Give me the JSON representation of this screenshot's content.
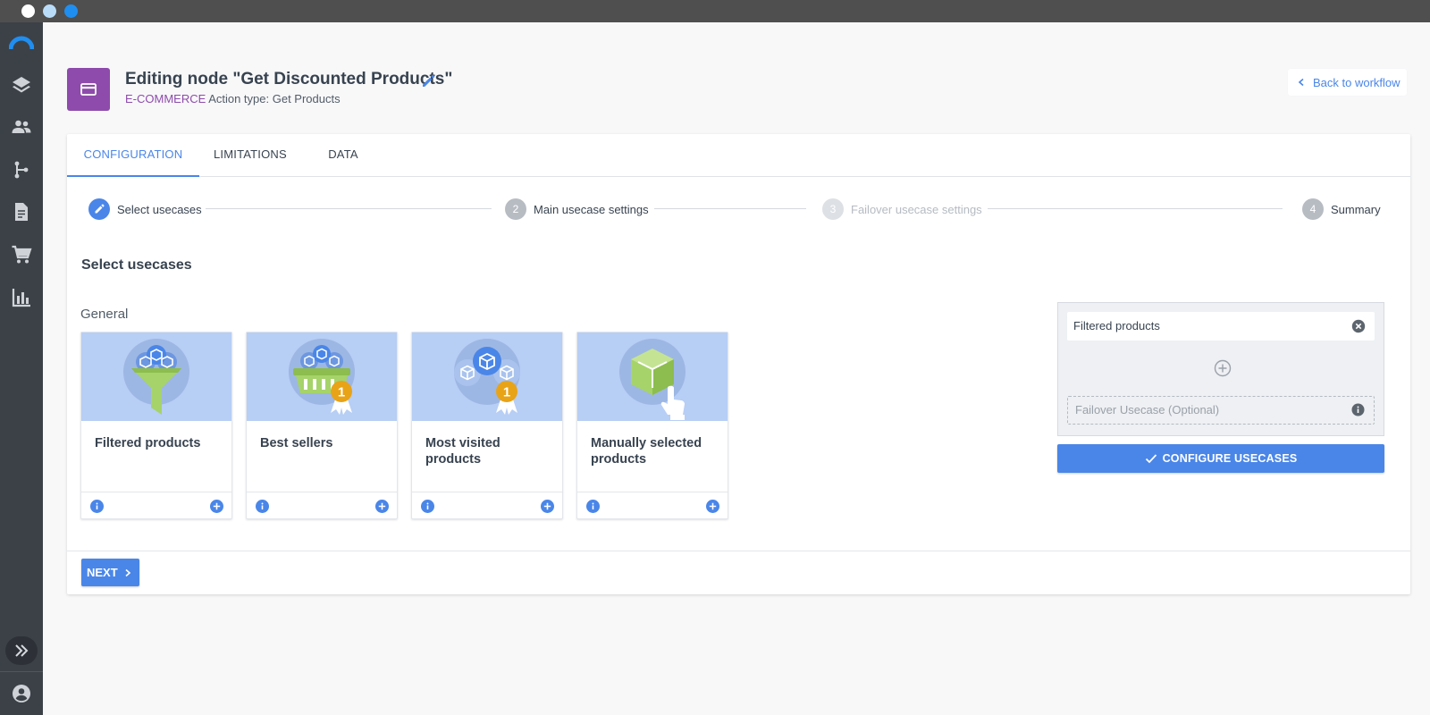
{
  "window": {
    "controls": [
      "close",
      "minimize",
      "maximize"
    ]
  },
  "sidebar": {
    "logo": "brand-logo",
    "items": [
      {
        "icon": "layers-icon"
      },
      {
        "icon": "users-icon"
      },
      {
        "icon": "workflow-icon"
      },
      {
        "icon": "document-icon"
      },
      {
        "icon": "cart-icon"
      },
      {
        "icon": "analytics-icon"
      }
    ],
    "expand_icon": "double-chevron-right-icon",
    "user_icon": "account-icon"
  },
  "header": {
    "title": "Editing node \"Get Discounted Products\"",
    "category": "E-COMMERCE",
    "action_type": "Action type: Get Products",
    "back_label": "Back to workflow",
    "node_color": "#8e4bab"
  },
  "tabs": [
    {
      "label": "CONFIGURATION",
      "active": true
    },
    {
      "label": "LIMITATIONS",
      "active": false
    },
    {
      "label": "DATA",
      "active": false
    }
  ],
  "stepper": [
    {
      "number": "",
      "label": "Select usecases",
      "state": "done"
    },
    {
      "number": "2",
      "label": "Main usecase settings",
      "state": "pending"
    },
    {
      "number": "3",
      "label": "Failover usecase settings",
      "state": "disabled"
    },
    {
      "number": "4",
      "label": "Summary",
      "state": "pending"
    }
  ],
  "section_title": "Select usecases",
  "group_title": "General",
  "usecases": [
    {
      "name": "Filtered products",
      "icon": "filter-products-icon"
    },
    {
      "name": "Best sellers",
      "icon": "basket-award-icon"
    },
    {
      "name": "Most visited products",
      "icon": "cubes-award-icon"
    },
    {
      "name": "Manually selected products",
      "icon": "cube-hand-icon"
    }
  ],
  "selection": {
    "selected_item": "Filtered products",
    "failover_placeholder": "Failover Usecase (Optional)",
    "configure_label": "CONFIGURE USECASES"
  },
  "footer": {
    "next_label": "NEXT"
  },
  "colors": {
    "accent": "#4a86e8",
    "tile_bg": "#b7cef5",
    "green": "#a6d36a",
    "badge": "#e8a317"
  }
}
